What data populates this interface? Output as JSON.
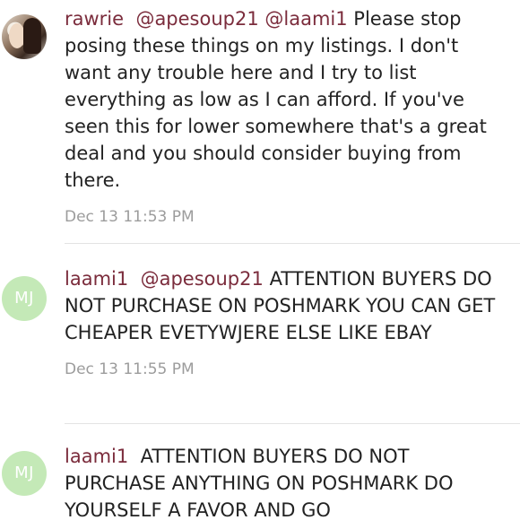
{
  "comments": [
    {
      "username": "rawrie",
      "mentions": "@apesoup21 @laami1",
      "message": "Please stop posing these things on my listings. I don't want any trouble here and I try to list everything as low as I can afford. If you've seen this for lower somewhere that's a great deal and you should consider buying from there.",
      "timestamp": "Dec 13 11:53 PM",
      "avatar": {
        "type": "photo",
        "icon": "user-photo-avatar"
      }
    },
    {
      "username": "laami1",
      "mentions": "@apesoup21",
      "message": "ATTENTION BUYERS DO NOT PURCHASE ON POSHMARK YOU CAN GET CHEAPER EVETYWJERE ELSE LIKE EBAY",
      "timestamp": "Dec 13 11:55 PM",
      "avatar": {
        "type": "initials",
        "initials": "MJ",
        "color": "#c4e9b7"
      }
    },
    {
      "username": "laami1",
      "mentions": "",
      "message": "ATTENTION BUYERS DO NOT PURCHASE ANYTHING ON POSHMARK DO YOURSELF A FAVOR AND GO",
      "timestamp": "",
      "avatar": {
        "type": "initials",
        "initials": "MJ",
        "color": "#c4e9b7"
      }
    }
  ],
  "colors": {
    "username": "#7b2c3c",
    "text": "#222222",
    "timestamp": "#9c9c9c",
    "divider": "#e3e3e3"
  }
}
